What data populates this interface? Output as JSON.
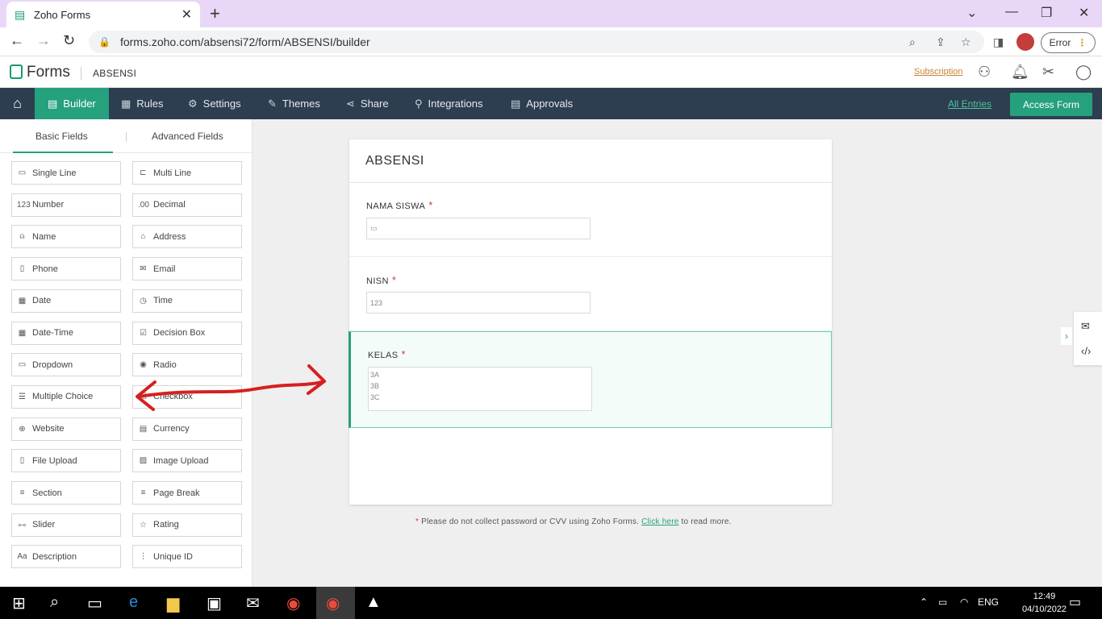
{
  "browser": {
    "tab_title": "Zoho Forms",
    "url": "forms.zoho.com/absensi72/form/ABSENSI/builder",
    "error_label": "Error"
  },
  "app": {
    "logo": "Forms",
    "form_name": "ABSENSI",
    "subscription": "Subscription"
  },
  "nav": {
    "items": [
      "Builder",
      "Rules",
      "Settings",
      "Themes",
      "Share",
      "Integrations",
      "Approvals"
    ],
    "all_entries": "All Entries",
    "access_form": "Access Form"
  },
  "left_panel": {
    "tabs": [
      "Basic Fields",
      "Advanced Fields"
    ],
    "fields": [
      {
        "label": "Single Line",
        "icon": "▭"
      },
      {
        "label": "Multi Line",
        "icon": "⊏"
      },
      {
        "label": "Number",
        "icon": "123"
      },
      {
        "label": "Decimal",
        "icon": ".00"
      },
      {
        "label": "Name",
        "icon": "⍝"
      },
      {
        "label": "Address",
        "icon": "⌂"
      },
      {
        "label": "Phone",
        "icon": "▯"
      },
      {
        "label": "Email",
        "icon": "✉"
      },
      {
        "label": "Date",
        "icon": "▦"
      },
      {
        "label": "Time",
        "icon": "◷"
      },
      {
        "label": "Date-Time",
        "icon": "▦"
      },
      {
        "label": "Decision Box",
        "icon": "☑"
      },
      {
        "label": "Dropdown",
        "icon": "▭"
      },
      {
        "label": "Radio",
        "icon": "◉"
      },
      {
        "label": "Multiple Choice",
        "icon": "☰"
      },
      {
        "label": "Checkbox",
        "icon": "☑"
      },
      {
        "label": "Website",
        "icon": "⊕"
      },
      {
        "label": "Currency",
        "icon": "▤"
      },
      {
        "label": "File Upload",
        "icon": "▯"
      },
      {
        "label": "Image Upload",
        "icon": "▨"
      },
      {
        "label": "Section",
        "icon": "≡"
      },
      {
        "label": "Page Break",
        "icon": "≡"
      },
      {
        "label": "Slider",
        "icon": "⧟"
      },
      {
        "label": "Rating",
        "icon": "☆"
      },
      {
        "label": "Description",
        "icon": "Aa"
      },
      {
        "label": "Unique ID",
        "icon": "⋮"
      }
    ]
  },
  "form": {
    "title": "ABSENSI",
    "fields": [
      {
        "label": "NAMA SISWA",
        "required": "*",
        "input_hint": "▭"
      },
      {
        "label": "NISN",
        "required": "*",
        "input_hint": "123"
      },
      {
        "label": "KELAS",
        "required": "*",
        "options": [
          "3A",
          "3B",
          "3C"
        ]
      }
    ],
    "notice_star": "*",
    "notice_text": "Please do not collect password or CVV using Zoho Forms.",
    "notice_link": "Click here",
    "notice_tail": "to read more."
  },
  "taskbar": {
    "lang": "ENG",
    "time": "12:49",
    "date": "04/10/2022"
  },
  "colors": {
    "accent": "#26a17d",
    "navbar": "#2d3e50",
    "tabbar": "#e9d7f7",
    "annotation_arrow": "#d62020"
  }
}
